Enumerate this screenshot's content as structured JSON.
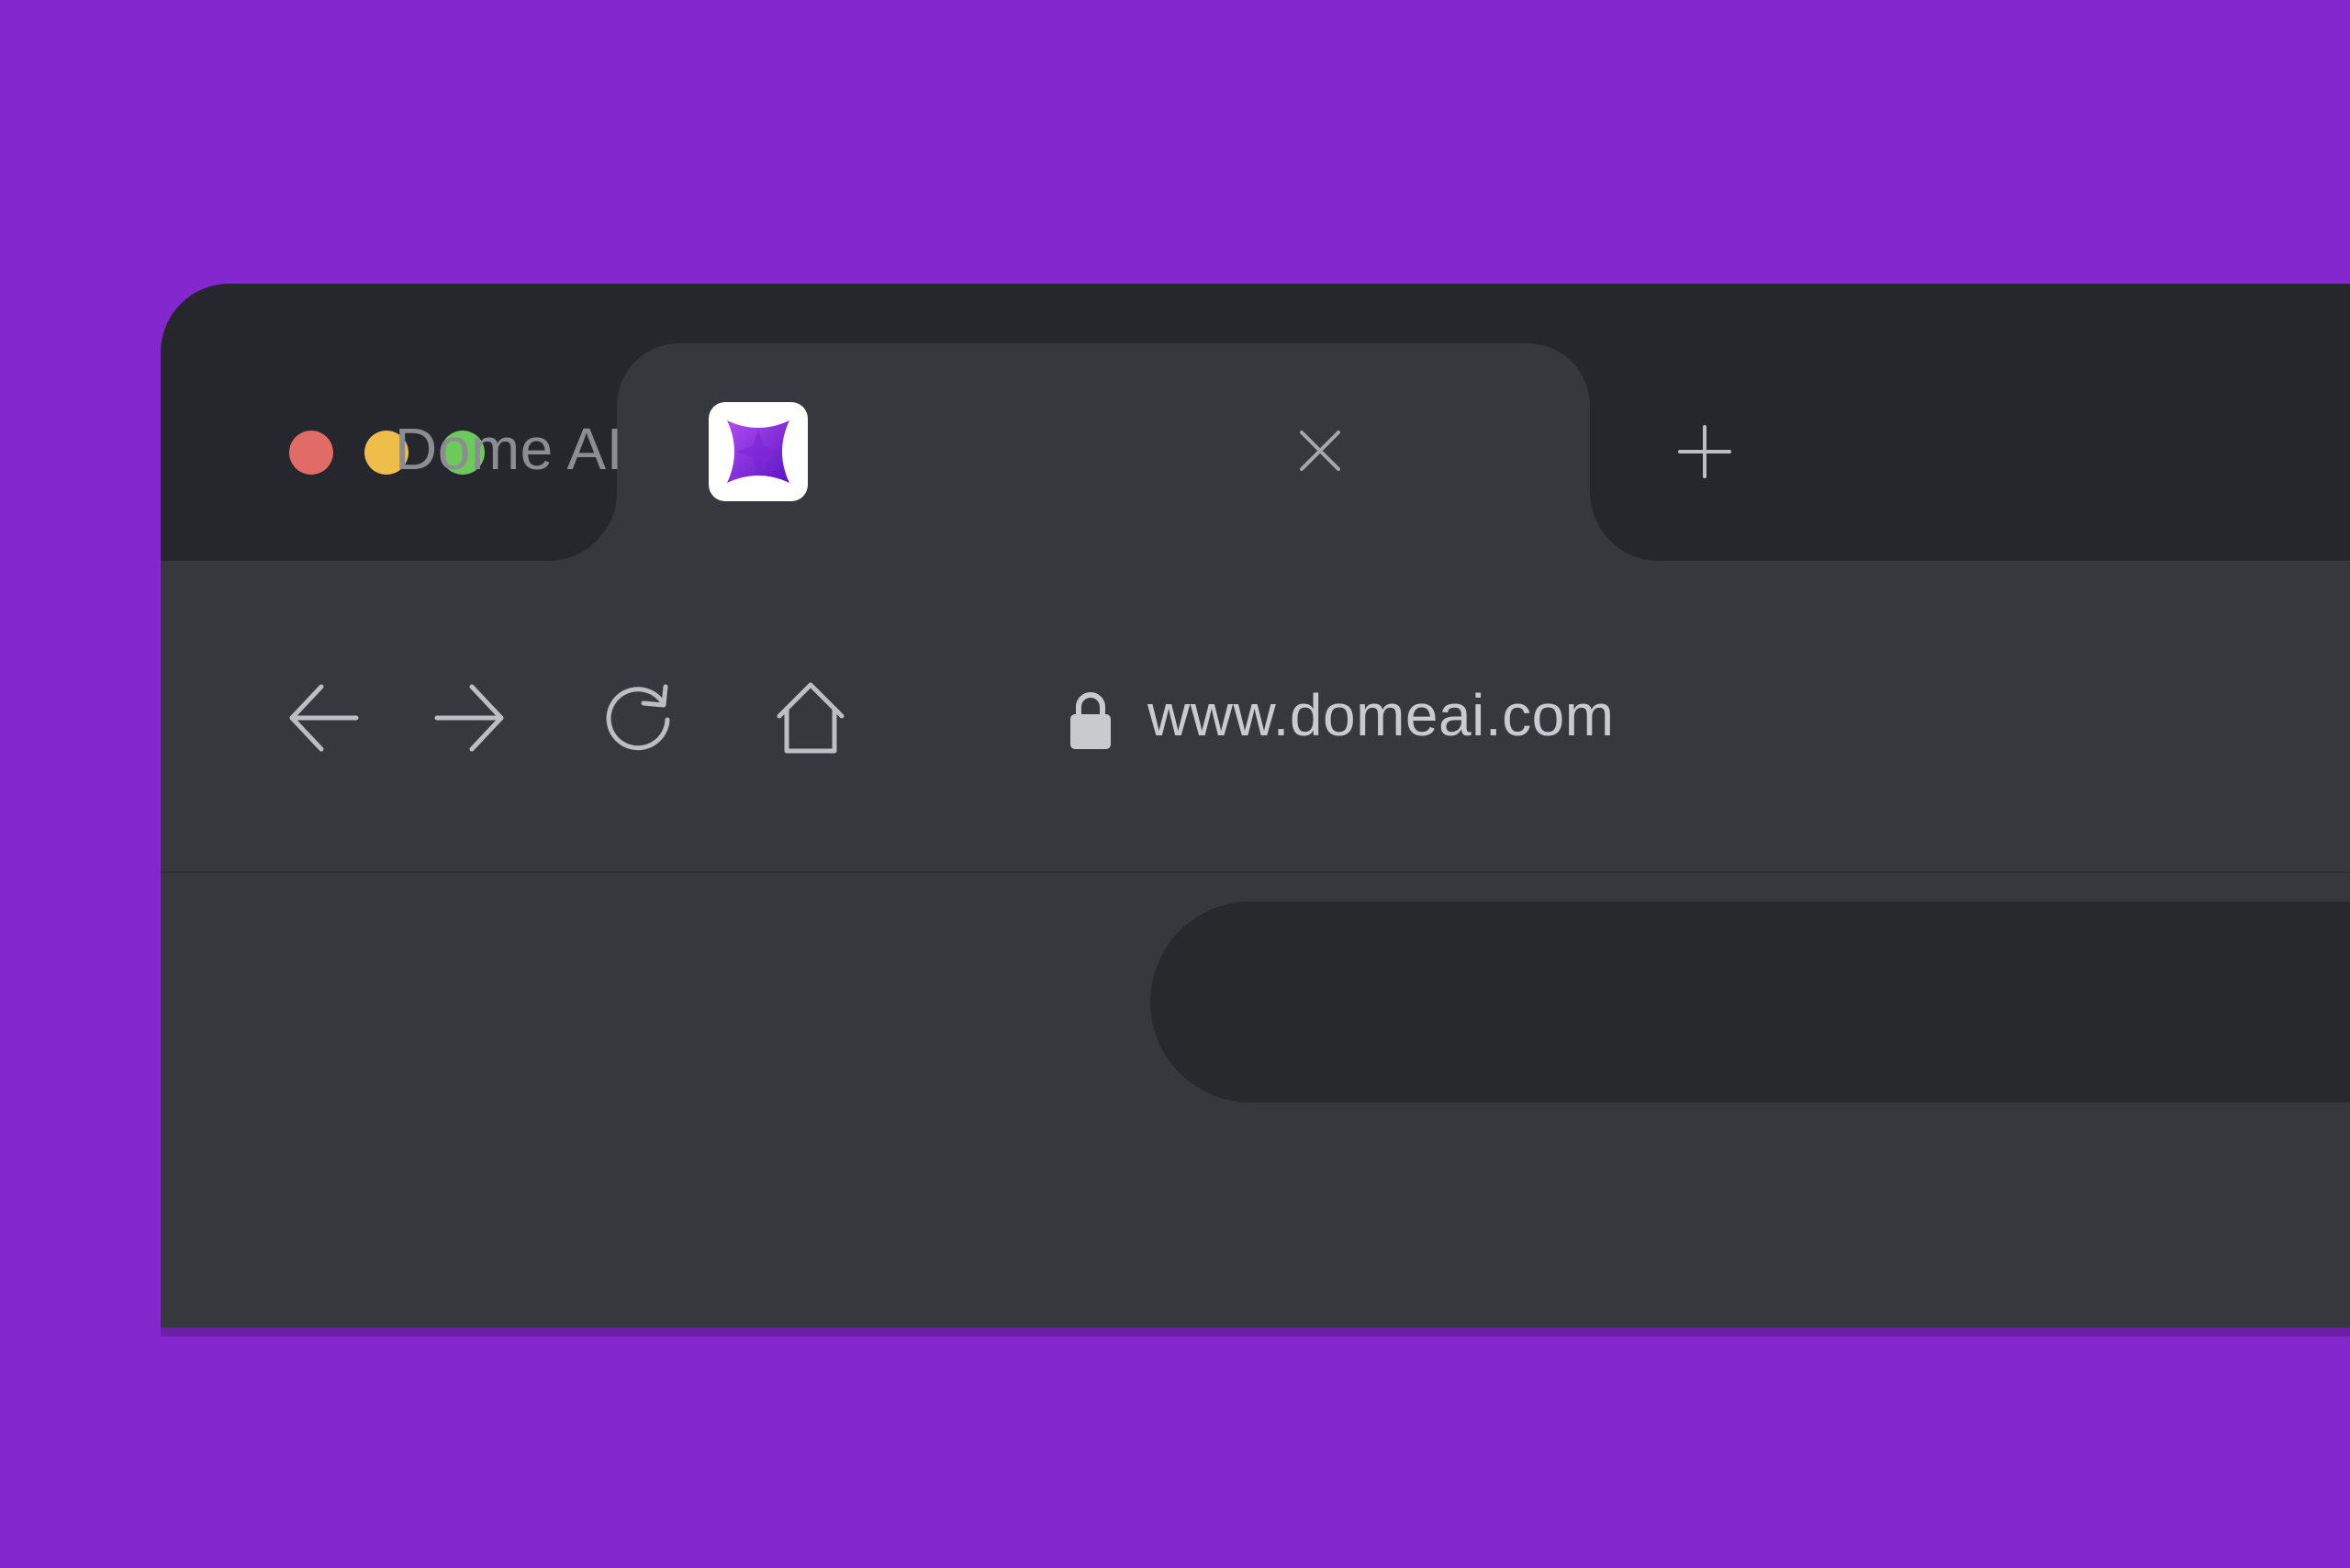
{
  "colors": {
    "background": "#8527cf",
    "tabbar": "#26272c",
    "chrome": "#37383d",
    "urlbar": "#28292d",
    "close_dot": "#e16b66",
    "minimize_dot": "#eebd4a",
    "maximize_dot": "#6cca5a",
    "icon_stroke": "#bdbec2",
    "brand_purple": "#7a22d6"
  },
  "window_controls": [
    {
      "role": "close",
      "color": "#e16b66"
    },
    {
      "role": "minimize",
      "color": "#eebd4a"
    },
    {
      "role": "maximize",
      "color": "#6cca5a"
    }
  ],
  "tab": {
    "title": "Dome AI",
    "favicon": "dome-ai-logo-icon",
    "close_icon": "close-icon"
  },
  "new_tab_icon": "plus-icon",
  "toolbar": {
    "back_icon": "arrow-left-icon",
    "forward_icon": "arrow-right-icon",
    "reload_icon": "reload-icon",
    "home_icon": "home-icon"
  },
  "address_bar": {
    "url": "www.domeai.com",
    "security_icon": "lock-icon"
  }
}
